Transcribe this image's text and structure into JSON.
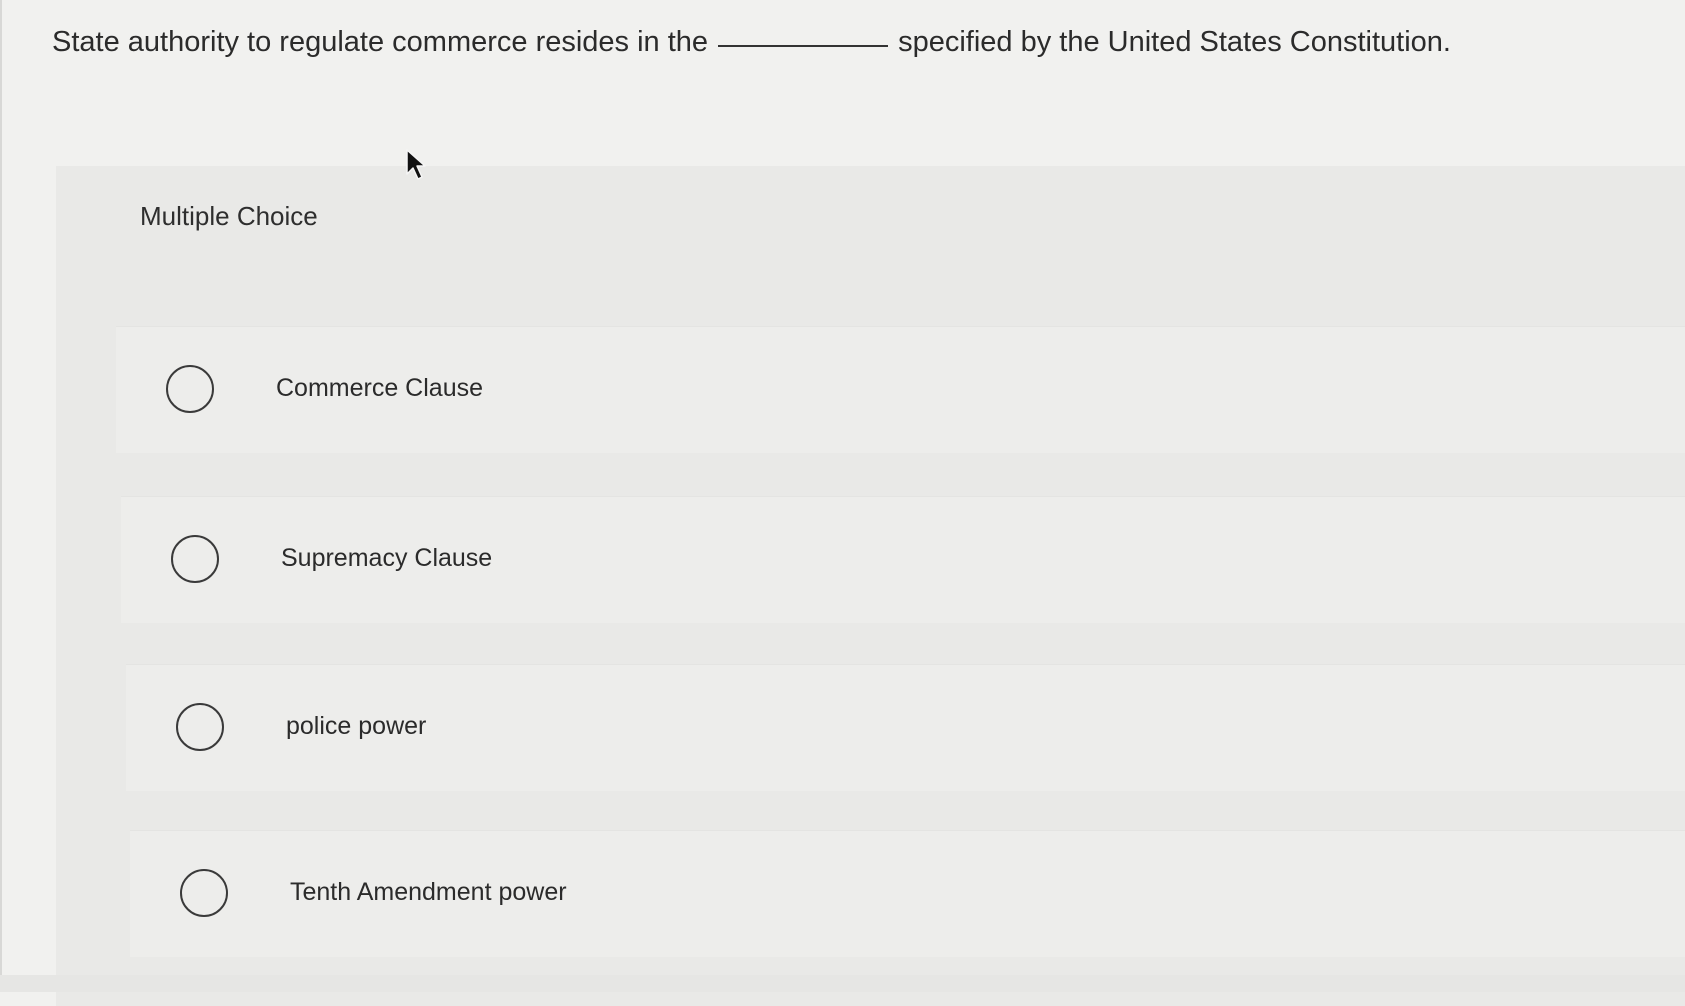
{
  "question": {
    "before_blank": "State authority to regulate commerce resides in the",
    "after_blank": "specified by the United States Constitution."
  },
  "card": {
    "title": "Multiple Choice"
  },
  "options": [
    {
      "label": "Commerce Clause"
    },
    {
      "label": "Supremacy Clause"
    },
    {
      "label": "police power"
    },
    {
      "label": "Tenth Amendment power"
    }
  ]
}
